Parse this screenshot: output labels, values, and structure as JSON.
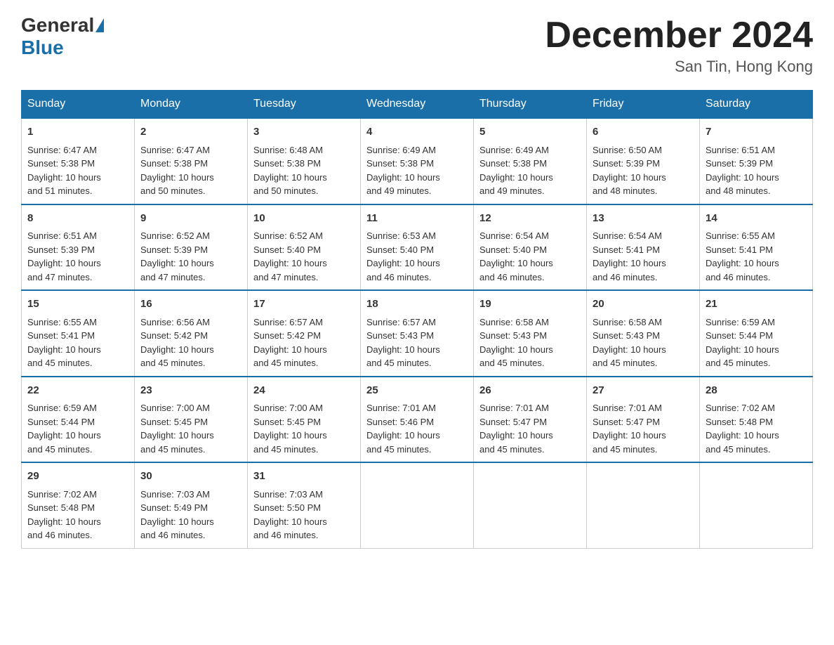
{
  "logo": {
    "general": "General",
    "blue": "Blue"
  },
  "title": "December 2024",
  "location": "San Tin, Hong Kong",
  "days_header": [
    "Sunday",
    "Monday",
    "Tuesday",
    "Wednesday",
    "Thursday",
    "Friday",
    "Saturday"
  ],
  "weeks": [
    [
      {
        "day": "1",
        "sunrise": "6:47 AM",
        "sunset": "5:38 PM",
        "daylight": "10 hours and 51 minutes."
      },
      {
        "day": "2",
        "sunrise": "6:47 AM",
        "sunset": "5:38 PM",
        "daylight": "10 hours and 50 minutes."
      },
      {
        "day": "3",
        "sunrise": "6:48 AM",
        "sunset": "5:38 PM",
        "daylight": "10 hours and 50 minutes."
      },
      {
        "day": "4",
        "sunrise": "6:49 AM",
        "sunset": "5:38 PM",
        "daylight": "10 hours and 49 minutes."
      },
      {
        "day": "5",
        "sunrise": "6:49 AM",
        "sunset": "5:38 PM",
        "daylight": "10 hours and 49 minutes."
      },
      {
        "day": "6",
        "sunrise": "6:50 AM",
        "sunset": "5:39 PM",
        "daylight": "10 hours and 48 minutes."
      },
      {
        "day": "7",
        "sunrise": "6:51 AM",
        "sunset": "5:39 PM",
        "daylight": "10 hours and 48 minutes."
      }
    ],
    [
      {
        "day": "8",
        "sunrise": "6:51 AM",
        "sunset": "5:39 PM",
        "daylight": "10 hours and 47 minutes."
      },
      {
        "day": "9",
        "sunrise": "6:52 AM",
        "sunset": "5:39 PM",
        "daylight": "10 hours and 47 minutes."
      },
      {
        "day": "10",
        "sunrise": "6:52 AM",
        "sunset": "5:40 PM",
        "daylight": "10 hours and 47 minutes."
      },
      {
        "day": "11",
        "sunrise": "6:53 AM",
        "sunset": "5:40 PM",
        "daylight": "10 hours and 46 minutes."
      },
      {
        "day": "12",
        "sunrise": "6:54 AM",
        "sunset": "5:40 PM",
        "daylight": "10 hours and 46 minutes."
      },
      {
        "day": "13",
        "sunrise": "6:54 AM",
        "sunset": "5:41 PM",
        "daylight": "10 hours and 46 minutes."
      },
      {
        "day": "14",
        "sunrise": "6:55 AM",
        "sunset": "5:41 PM",
        "daylight": "10 hours and 46 minutes."
      }
    ],
    [
      {
        "day": "15",
        "sunrise": "6:55 AM",
        "sunset": "5:41 PM",
        "daylight": "10 hours and 45 minutes."
      },
      {
        "day": "16",
        "sunrise": "6:56 AM",
        "sunset": "5:42 PM",
        "daylight": "10 hours and 45 minutes."
      },
      {
        "day": "17",
        "sunrise": "6:57 AM",
        "sunset": "5:42 PM",
        "daylight": "10 hours and 45 minutes."
      },
      {
        "day": "18",
        "sunrise": "6:57 AM",
        "sunset": "5:43 PM",
        "daylight": "10 hours and 45 minutes."
      },
      {
        "day": "19",
        "sunrise": "6:58 AM",
        "sunset": "5:43 PM",
        "daylight": "10 hours and 45 minutes."
      },
      {
        "day": "20",
        "sunrise": "6:58 AM",
        "sunset": "5:43 PM",
        "daylight": "10 hours and 45 minutes."
      },
      {
        "day": "21",
        "sunrise": "6:59 AM",
        "sunset": "5:44 PM",
        "daylight": "10 hours and 45 minutes."
      }
    ],
    [
      {
        "day": "22",
        "sunrise": "6:59 AM",
        "sunset": "5:44 PM",
        "daylight": "10 hours and 45 minutes."
      },
      {
        "day": "23",
        "sunrise": "7:00 AM",
        "sunset": "5:45 PM",
        "daylight": "10 hours and 45 minutes."
      },
      {
        "day": "24",
        "sunrise": "7:00 AM",
        "sunset": "5:45 PM",
        "daylight": "10 hours and 45 minutes."
      },
      {
        "day": "25",
        "sunrise": "7:01 AM",
        "sunset": "5:46 PM",
        "daylight": "10 hours and 45 minutes."
      },
      {
        "day": "26",
        "sunrise": "7:01 AM",
        "sunset": "5:47 PM",
        "daylight": "10 hours and 45 minutes."
      },
      {
        "day": "27",
        "sunrise": "7:01 AM",
        "sunset": "5:47 PM",
        "daylight": "10 hours and 45 minutes."
      },
      {
        "day": "28",
        "sunrise": "7:02 AM",
        "sunset": "5:48 PM",
        "daylight": "10 hours and 45 minutes."
      }
    ],
    [
      {
        "day": "29",
        "sunrise": "7:02 AM",
        "sunset": "5:48 PM",
        "daylight": "10 hours and 46 minutes."
      },
      {
        "day": "30",
        "sunrise": "7:03 AM",
        "sunset": "5:49 PM",
        "daylight": "10 hours and 46 minutes."
      },
      {
        "day": "31",
        "sunrise": "7:03 AM",
        "sunset": "5:50 PM",
        "daylight": "10 hours and 46 minutes."
      },
      null,
      null,
      null,
      null
    ]
  ],
  "labels": {
    "sunrise": "Sunrise:",
    "sunset": "Sunset:",
    "daylight": "Daylight:"
  }
}
